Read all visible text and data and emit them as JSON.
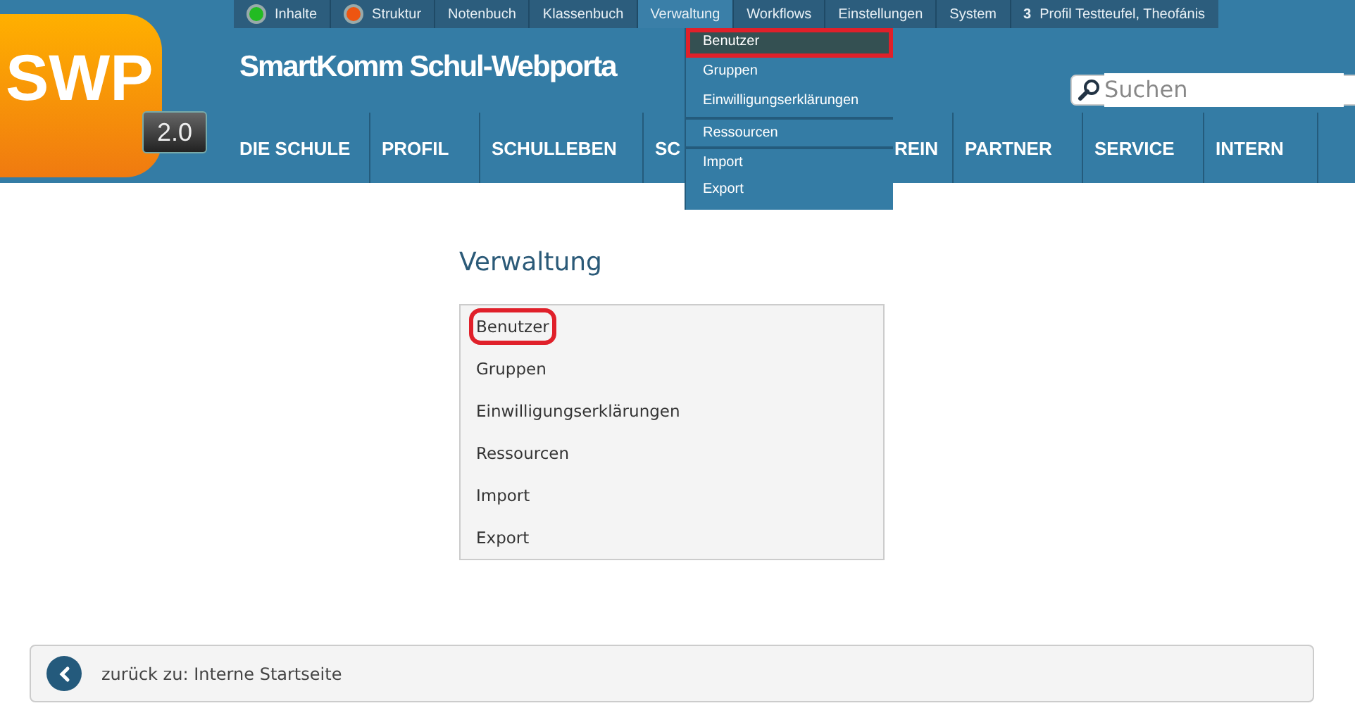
{
  "top_bar": {
    "items": [
      {
        "label": "Inhalte",
        "color": "#22bb22",
        "open": false
      },
      {
        "label": "Struktur",
        "color": "#ee5511",
        "open": false
      },
      {
        "label": "Notenbuch",
        "open": false
      },
      {
        "label": "Klassenbuch",
        "open": false
      },
      {
        "label": "Verwaltung",
        "open": true
      },
      {
        "label": "Workflows",
        "open": false
      },
      {
        "label": "Einstellungen",
        "open": false
      },
      {
        "label": "System",
        "open": false
      },
      {
        "label": "**3** Profil Testteufel, Theofánis",
        "open": false
      }
    ]
  },
  "logo": {
    "text": "SWP",
    "version": "2.0"
  },
  "site_title": "SmartKomm Schul-Webporta",
  "search": {
    "placeholder": "Suchen"
  },
  "main_nav": [
    "DIE SCHULE",
    "PROFIL",
    "SCHULLEBEN",
    "SC",
    "REIN",
    "PARTNER",
    "SERVICE",
    "INTERN"
  ],
  "dropdown": {
    "items": [
      {
        "label": "Benutzer",
        "selected": true,
        "highlighted": true,
        "separator_before": false
      },
      {
        "label": "Gruppen",
        "selected": false,
        "highlighted": false,
        "separator_before": false
      },
      {
        "label": "Einwilligungserklärungen",
        "selected": false,
        "highlighted": false,
        "separator_before": false
      },
      {
        "label": "Ressourcen",
        "selected": false,
        "highlighted": false,
        "separator_before": true
      },
      {
        "label": "Import",
        "selected": false,
        "highlighted": false,
        "separator_before": true
      },
      {
        "label": "Export",
        "selected": false,
        "highlighted": false,
        "separator_before": false
      }
    ]
  },
  "page": {
    "heading": "Verwaltung",
    "links": [
      {
        "label": "Benutzer",
        "highlighted": true
      },
      {
        "label": "Gruppen",
        "highlighted": false
      },
      {
        "label": "Einwilligungserklärungen",
        "highlighted": false
      },
      {
        "label": "Ressourcen",
        "highlighted": false
      },
      {
        "label": "Import",
        "highlighted": false
      },
      {
        "label": "Export",
        "highlighted": false
      }
    ]
  },
  "back_bar": {
    "label": "zurück zu: Interne Startseite"
  }
}
